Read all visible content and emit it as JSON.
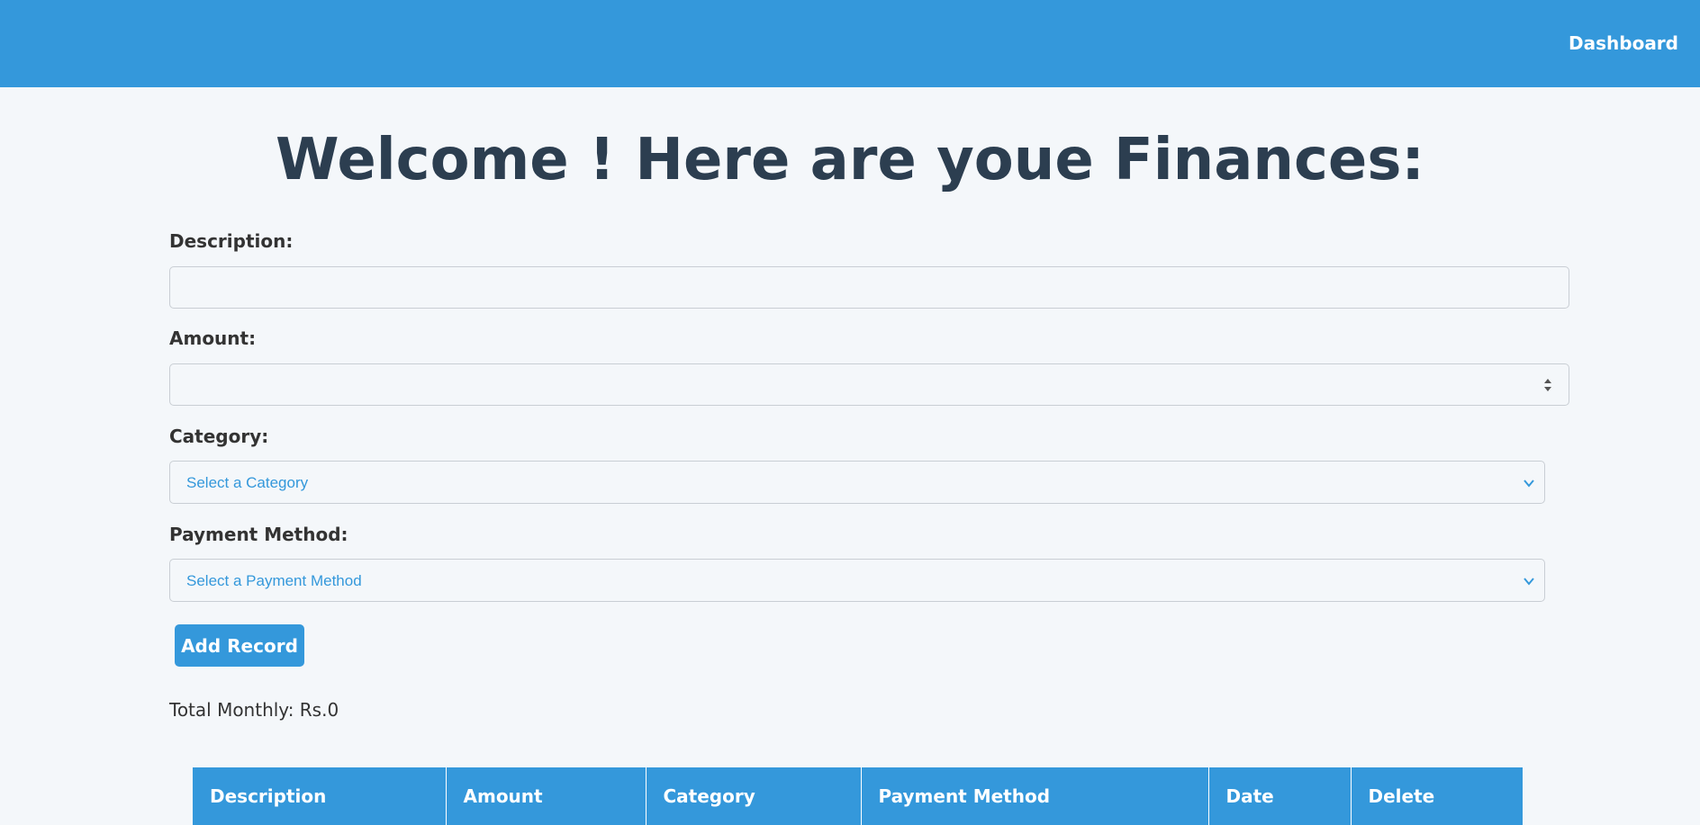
{
  "header": {
    "nav_link": "Dashboard"
  },
  "main": {
    "title": "Welcome ! Here are youe Finances:"
  },
  "form": {
    "description_label": "Description:",
    "description_value": "",
    "amount_label": "Amount:",
    "amount_value": "",
    "category_label": "Category:",
    "category_selected": "Select a Category",
    "payment_label": "Payment Method:",
    "payment_selected": "Select a Payment Method",
    "add_button": "Add Record"
  },
  "summary": {
    "total_monthly": "Total Monthly: Rs.0"
  },
  "table": {
    "columns": [
      "Description",
      "Amount",
      "Category",
      "Payment Method",
      "Date",
      "Delete"
    ]
  },
  "colors": {
    "accent": "#3498db",
    "title": "#2c3e50",
    "background": "#f4f7fa"
  },
  "icons": {
    "spinner": "number-spinner-icon",
    "dropdown": "chevron-down-icon"
  }
}
